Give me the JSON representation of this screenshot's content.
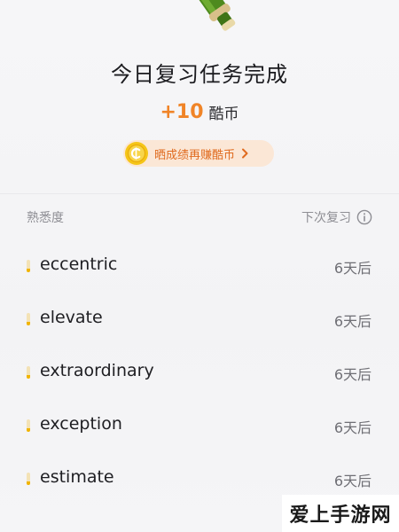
{
  "completion": {
    "title": "今日复习任务完成",
    "reward_amount": "+10",
    "reward_unit": "酷币",
    "share_button_label": "晒成绩再赚酷币"
  },
  "list_header": {
    "left": "熟悉度",
    "right": "下次复习"
  },
  "words": [
    {
      "word": "eccentric",
      "next_review": "6天后",
      "familiarity": 0.3
    },
    {
      "word": "elevate",
      "next_review": "6天后",
      "familiarity": 0.3
    },
    {
      "word": "extraordinary",
      "next_review": "6天后",
      "familiarity": 0.3
    },
    {
      "word": "exception",
      "next_review": "6天后",
      "familiarity": 0.3
    },
    {
      "word": "estimate",
      "next_review": "6天后",
      "familiarity": 0.3
    }
  ],
  "watermark": "爱上手游网",
  "colors": {
    "accent_orange": "#f08427",
    "pill_bg": "#fbe7d6",
    "coin": "#f5c518",
    "familiarity_fill": "#f1b400"
  },
  "icons": [
    "champagne-bottle-icon",
    "coin-icon",
    "chevron-right-icon",
    "info-icon"
  ]
}
